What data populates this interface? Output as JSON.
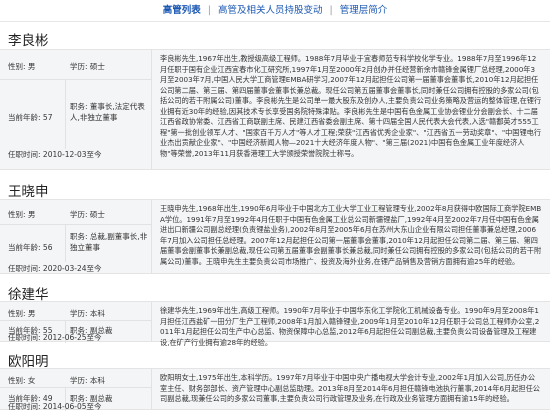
{
  "tabs": {
    "active": "高管列表",
    "t2": "高管及相关人员持股变动",
    "t3": "管理层简介",
    "sep": "|"
  },
  "labels": {
    "gender": "性别:",
    "education": "学历:",
    "age": "当前年龄:",
    "position": "职务:",
    "term": "任职时间:"
  },
  "people": [
    {
      "name": "李良彬",
      "gender": "男",
      "education": "硕士",
      "age": "57",
      "position": "董事长,法定代表人,非独立董事",
      "term": "2010-12-03至今",
      "bio": "李良彬先生,1967年出生,教授级高级工程师。1988年7月毕业于宜春师范专科学校化学专业。1988年7月至1996年12月任职于国有企业江西宜春市化工研究所,1997年1月至2000年2月创办并任经营新余市赣锋金属锂厂总经理,2000年3月至2003年7月,中国人民大学工商管理EMBA研学习,2007年12月起担任公司第一届董事会董事长,2010年12月起担任公司第二届、第三届、第四届董事会董事长兼总裁。现任公司第五届董事会董事长,同时兼任公司拥有控股的多家公司(包括公司的若干附属公司)董事。李良彬先生是公司单一最大股东及创办人,主要负责公司业务策略及营运的整体管理,在锂行业拥有近30年的经验,因其技术专长享受国务院特殊津贴。李良彬先生是中国有色金属工业协会锂业分会副会长、十二届江西省政协常委、江西省工商联副主席、民建江西省委会副主席、第十四届全国人民代表大会代表,入选\"赣鄱英才555工程\"第一批创业领军人才、\"国家百千万人才\"等人才工程;荣获\"江西省优秀企业家\"、\"江西省五一劳动奖章\"、\"中国锂电行业杰出贡献企业家\"、\"中国经济新闻人物—2021十大经济年度人物\"、\"第三届(2021)中国有色金属工业年度经济人物\"等荣誉,2013年11月获香港理工大学颁授荣誉院院士称号。"
    },
    {
      "name": "王晓申",
      "gender": "男",
      "education": "硕士",
      "age": "56",
      "position": "总裁,副董事长,非独立董事",
      "term": "2020-03-24至今",
      "bio": "王晓申先生,1968年出生,1990年6月毕业于中国北方工业大学工业工程管理专业,2002年8月获得中欧国际工商学院EMBA学位。1991年7月至1992年4月任职于中国有色金属工业总公司新疆锂盐厂,1992年4月至2002年7月任中国有色金属进出口新疆公司副总经理(负责锂盐业务),2002年8月至2005年6月在苏州大东山企业有限公司担任董事兼总经理,2006年7月加入公司担任总经理。2007年12月起担任公司第一届董事会董事,2010年12月起担任公司第二届、第三届、第四届董事会副董事长兼副总裁,现任公司第五届董事会副董事长兼总裁,同时兼任公司拥有控股的多家公司(包括公司的若干附属公司)董事。王晓申先生主要负责公司市场推广、投资及海外业务,在锂产品销售及营销方面拥有逾25年的经验。"
    },
    {
      "name": "徐建华",
      "gender": "男",
      "education": "本科",
      "age": "55",
      "position": "副总裁",
      "term": "2012-06-25至今",
      "bio": "徐建华先生,1969年出生,高级工程师。1990年7月毕业于中国华东化工学院化工机械设备专业。1990年9月至2008年1月担任江西盐矿一田分厂生产工程师,2008年1月加入赣锋锂业,2009年1月至2010年12月任职于公司总工程师办公室,2011年1月起担任公司生产中心总监、物资保障中心总监,2012年6月起担任公司副总裁,主要负责公司设备管理及工程建设,在矿产行业拥有逾28年的经验。"
    },
    {
      "name": "欧阳明",
      "gender": "女",
      "education": "本科",
      "age": "49",
      "position": "副总裁",
      "term": "2014-06-05至今",
      "bio": "欧阳明女士,1975年出生,本科学历。1997年7月毕业于中国中央广播电视大学会计专业,2002年1月加入公司,历任办公室主任、财务部部长、资产管理中心副总监助理。2013年8月至2014年6月担任赣锋电池执行董事,2014年6月起担任公司副总裁,现兼任公司的多家公司董事,主要负责公司行政管理及业务,在行政及业务管理方面拥有逾15年的经验。"
    }
  ]
}
